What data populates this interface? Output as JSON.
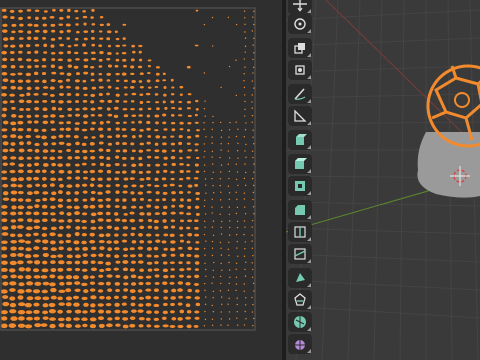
{
  "uv_editor": {
    "island_color": "#f28a2e",
    "background_color": "#2f2f2f",
    "bounds_color": "#5a5a5a"
  },
  "viewport": {
    "background_color": "#3a3a3a",
    "grid_color": "#444444",
    "x_axis_color": "#7a3b3b",
    "y_axis_color": "#5c8a2e",
    "object": {
      "base_color": "#9a9a9a",
      "sphere_wire_color": "#f28a2e"
    }
  },
  "toolbar": {
    "tools": [
      {
        "icon": "move-icon"
      },
      {
        "icon": "rotate-icon"
      },
      {
        "icon": "scale-icon"
      },
      {
        "icon": "transform-icon"
      },
      {
        "icon": "annotate-icon"
      },
      {
        "icon": "measure-icon"
      },
      {
        "icon": "add-cube-icon"
      },
      {
        "icon": "extrude-region-icon"
      },
      {
        "icon": "inset-faces-icon"
      },
      {
        "icon": "bevel-icon"
      },
      {
        "icon": "loop-cut-icon"
      },
      {
        "icon": "knife-icon"
      },
      {
        "icon": "poly-build-icon"
      },
      {
        "icon": "spin-icon"
      },
      {
        "icon": "smooth-icon"
      },
      {
        "icon": "shrink-fatten-icon"
      }
    ]
  }
}
